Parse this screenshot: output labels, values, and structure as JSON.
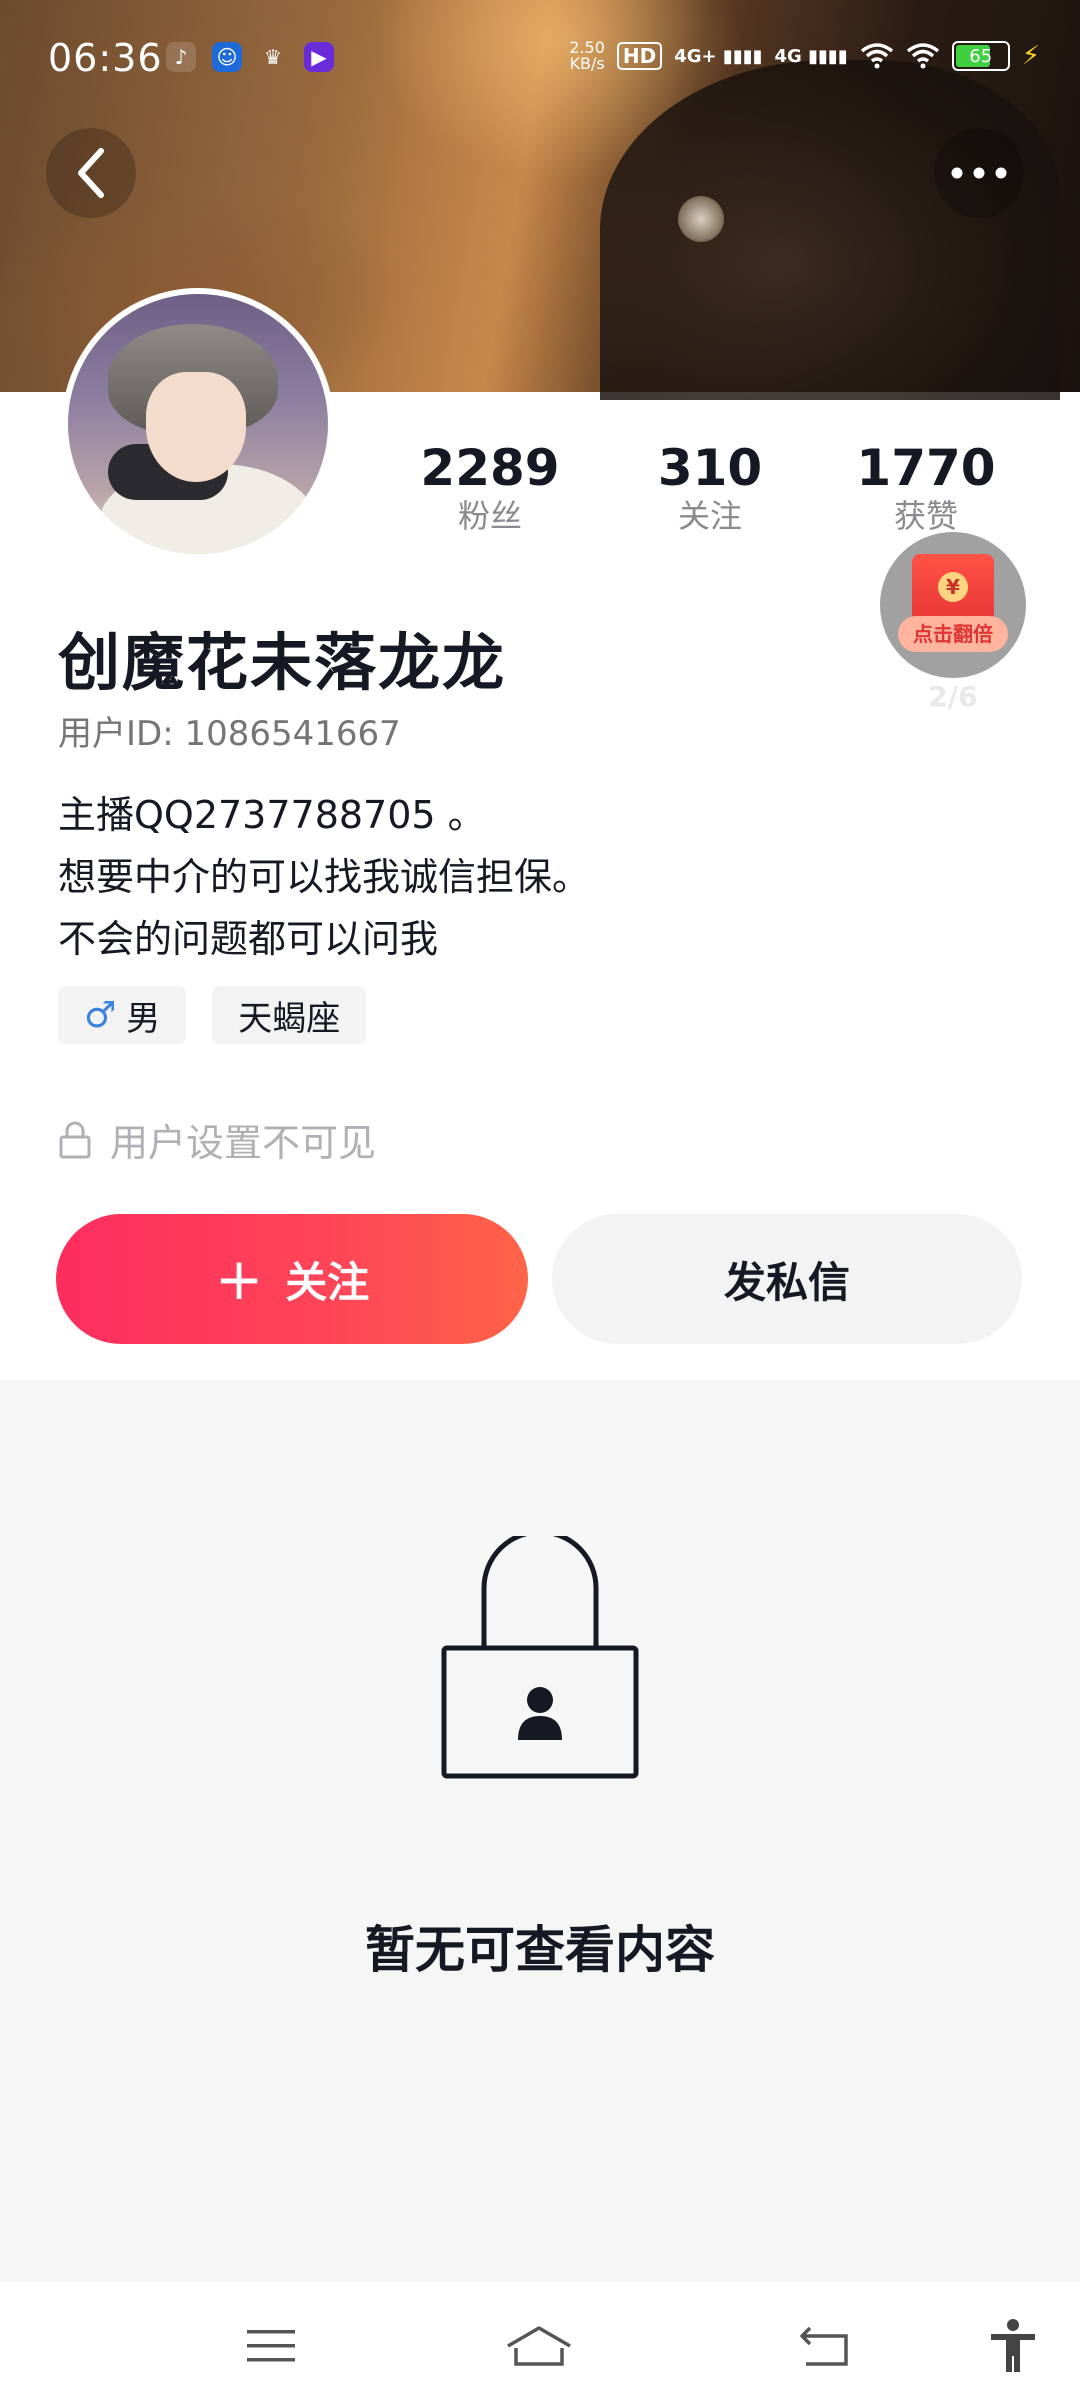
{
  "status_bar": {
    "time": "06:36",
    "network_speed": "2.50\nKB/s",
    "network_speed_top": "2.50",
    "network_speed_bottom": "KB/s",
    "hd_label": "HD",
    "signal1": "4G+",
    "signal2": "4G",
    "battery": "65"
  },
  "profile": {
    "nickname": "创魔花未落龙龙",
    "user_id": "用户ID: 1086541667",
    "bio": [
      "￼主播QQ2737788705 。",
      "想要中介的可以找我￼诚信担保。￼",
      "￼￼￼不会的问题都可以问我￼"
    ],
    "tags": {
      "gender_symbol": "♂",
      "gender": "男",
      "zodiac": "天蝎座"
    },
    "privacy_text": "用户设置不可见"
  },
  "stats": [
    {
      "num": "2289",
      "label": "粉丝"
    },
    {
      "num": "310",
      "label": "关注"
    },
    {
      "num": "1770",
      "label": "获赞"
    }
  ],
  "red_packet": {
    "coin": "¥",
    "label": "点击翻倍",
    "count": "2/6"
  },
  "actions": {
    "follow_plus": "+",
    "follow_label": "关注",
    "message_label": "发私信"
  },
  "empty_state": {
    "text": "暂无可查看内容"
  },
  "colors": {
    "follow_gradient_start": "#fd2d5e",
    "follow_gradient_end": "#ff6447",
    "gender_blue": "#3b82e0"
  }
}
